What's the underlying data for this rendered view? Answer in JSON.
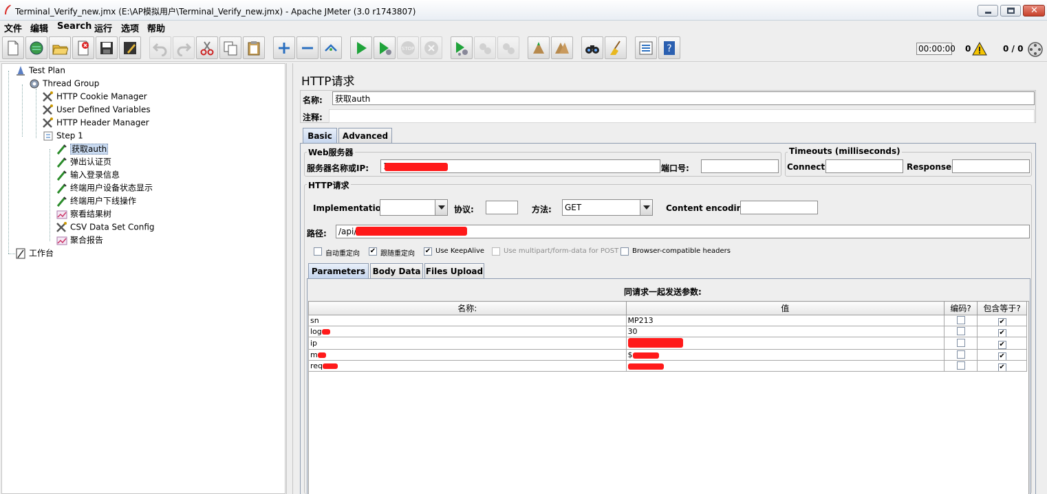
{
  "window": {
    "title": "Terminal_Verify_new.jmx (E:\\AP模拟用户\\Terminal_Verify_new.jmx) - Apache JMeter (3.0 r1743807)"
  },
  "menu": [
    "文件",
    "编辑",
    "Search",
    "运行",
    "选项",
    "帮助"
  ],
  "status": {
    "timer": "00:00:00",
    "warnings": "0",
    "threads": "0 / 0"
  },
  "toolbar_icons": [
    "new-icon",
    "templates-icon",
    "open-icon",
    "close-file-icon",
    "save-icon",
    "save-as-icon",
    "undo-icon",
    "redo-icon",
    "cut-icon",
    "copy-icon",
    "paste-icon",
    "expand-icon",
    "collapse-icon",
    "toggle-icon",
    "start-icon",
    "start-no-pause-icon",
    "stop-icon",
    "shutdown-icon",
    "remote-start-icon",
    "remote-stop-icon",
    "remote-shutdown-icon",
    "clear-icon",
    "clear-all-icon",
    "search-icon",
    "reset-search-icon",
    "function-helper-icon",
    "help-icon"
  ],
  "tree": {
    "test_plan": "Test Plan",
    "thread_group": "Thread Group",
    "cookie_manager": "HTTP Cookie Manager",
    "user_vars": "User Defined Variables",
    "header_manager": "HTTP Header Manager",
    "step1": "Step 1",
    "req_auth": "获取auth",
    "req_popup": "弹出认证页",
    "req_login": "输入登录信息",
    "req_status": "终端用户设备状态显示",
    "req_offline": "终端用户下线操作",
    "result_tree": "察看结果树",
    "csv": "CSV Data Set Config",
    "report": "聚合报告",
    "workbench": "工作台"
  },
  "panel": {
    "title": "HTTP请求",
    "name_label": "名称:",
    "name_value": "获取auth",
    "comment_label": "注释:",
    "comment_value": "",
    "tabs": [
      "Basic",
      "Advanced"
    ],
    "web_server": {
      "legend": "Web服务器",
      "server_label": "服务器名称或IP:",
      "server_value": "1",
      "port_label": "端口号:",
      "port_value": ""
    },
    "timeouts": {
      "legend": "Timeouts (milliseconds)",
      "connect_label": "Connect:",
      "connect_value": "",
      "response_label": "Response:",
      "response_value": ""
    },
    "http": {
      "legend": "HTTP请求",
      "impl_label": "Implementation:",
      "impl_value": "",
      "protocol_label": "协议:",
      "protocol_value": "",
      "method_label": "方法:",
      "method_value": "GET",
      "encoding_label": "Content encoding:",
      "encoding_value": "",
      "path_label": "路径:",
      "path_value": "/api/"
    },
    "options": [
      {
        "label": "自动重定向",
        "checked": false,
        "disabled": false
      },
      {
        "label": "跟随重定向",
        "checked": true,
        "disabled": false
      },
      {
        "label": "Use KeepAlive",
        "checked": true,
        "disabled": false
      },
      {
        "label": "Use multipart/form-data for POST",
        "checked": false,
        "disabled": true
      },
      {
        "label": "Browser-compatible headers",
        "checked": false,
        "disabled": false
      }
    ],
    "subtabs": [
      "Parameters",
      "Body Data",
      "Files Upload"
    ],
    "params": {
      "caption": "同请求一起发送参数:",
      "headers": [
        "名称:",
        "值",
        "编码?",
        "包含等于?"
      ],
      "rows": [
        {
          "name": "sn",
          "value": "MP213",
          "encode": false,
          "include_equals": true
        },
        {
          "name": "log",
          "value": "30",
          "encode": false,
          "include_equals": true
        },
        {
          "name": "ip",
          "value": "",
          "encode": false,
          "include_equals": true
        },
        {
          "name": "m",
          "value": "$",
          "encode": false,
          "include_equals": true
        },
        {
          "name": "req",
          "value": "",
          "encode": false,
          "include_equals": true
        }
      ]
    }
  }
}
